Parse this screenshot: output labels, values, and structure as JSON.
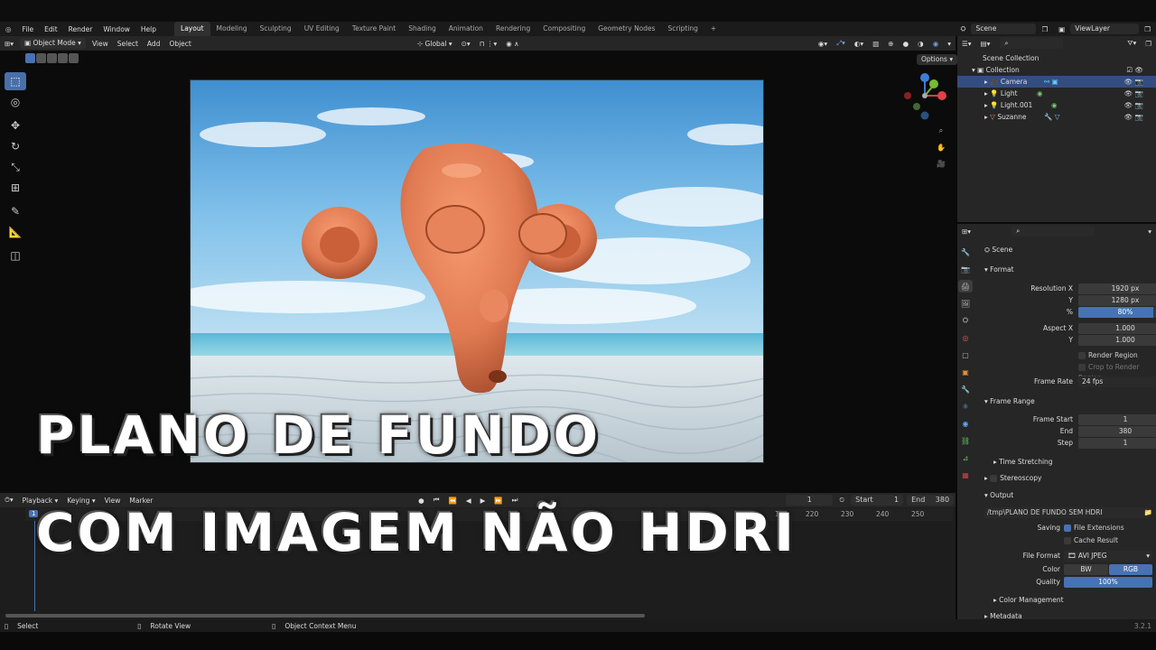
{
  "menu": {
    "file": "File",
    "edit": "Edit",
    "render": "Render",
    "window": "Window",
    "help": "Help"
  },
  "workspaces": [
    "Layout",
    "Modeling",
    "Sculpting",
    "UV Editing",
    "Texture Paint",
    "Shading",
    "Animation",
    "Rendering",
    "Compositing",
    "Geometry Nodes",
    "Scripting"
  ],
  "add_tab": "+",
  "scene": {
    "label": "Scene",
    "view_layer": "ViewLayer"
  },
  "viewport_header": {
    "mode": "Object Mode",
    "view": "View",
    "select": "Select",
    "add": "Add",
    "object": "Object",
    "transform": "Global",
    "options": "Options"
  },
  "overlay": {
    "line1": "PLANO DE FUNDO",
    "line2": "COM IMAGEM NÃO HDRI"
  },
  "gizmo": {
    "x": "X",
    "y": "Y",
    "z": "Z"
  },
  "timeline": {
    "playback": "Playback",
    "keying": "Keying",
    "view": "View",
    "marker": "Marker",
    "current": "1",
    "start_label": "Start",
    "start": "1",
    "end_label": "End",
    "end": "380",
    "ticks": [
      "10",
      "220",
      "230",
      "240",
      "250"
    ],
    "frame_marker": "1"
  },
  "status": {
    "select": "Select",
    "rotate": "Rotate View",
    "context": "Object Context Menu",
    "version": "3.2.1"
  },
  "outliner": {
    "root": "Scene Collection",
    "collection": "Collection",
    "items": [
      "Camera",
      "Light",
      "Light.001",
      "Suzanne"
    ]
  },
  "properties": {
    "scene": "Scene",
    "format": "Format",
    "res_x_label": "Resolution X",
    "res_x": "1920 px",
    "res_y_label": "Y",
    "res_y": "1280 px",
    "pct_label": "%",
    "pct": "80%",
    "aspect_x_label": "Aspect X",
    "aspect_x": "1.000",
    "aspect_y_label": "Y",
    "aspect_y": "1.000",
    "render_region": "Render Region",
    "crop": "Crop to Render Region",
    "frame_rate_label": "Frame Rate",
    "frame_rate": "24 fps",
    "frame_range": "Frame Range",
    "frame_start_label": "Frame Start",
    "frame_start": "1",
    "end_label": "End",
    "end": "380",
    "step_label": "Step",
    "step": "1",
    "time_stretching": "Time Stretching",
    "stereoscopy": "Stereoscopy",
    "output": "Output",
    "path": "/tmp\\PLANO DE FUNDO SEM HDRI",
    "saving_label": "Saving",
    "file_ext": "File Extensions",
    "cache": "Cache Result",
    "file_format_label": "File Format",
    "file_format": "AVI JPEG",
    "color_label": "Color",
    "bw": "BW",
    "rgb": "RGB",
    "quality_label": "Quality",
    "quality": "100%",
    "color_management": "Color Management",
    "metadata": "Metadata"
  },
  "colors": {
    "accent": "#4772b3",
    "monkey": "#e07a52"
  }
}
